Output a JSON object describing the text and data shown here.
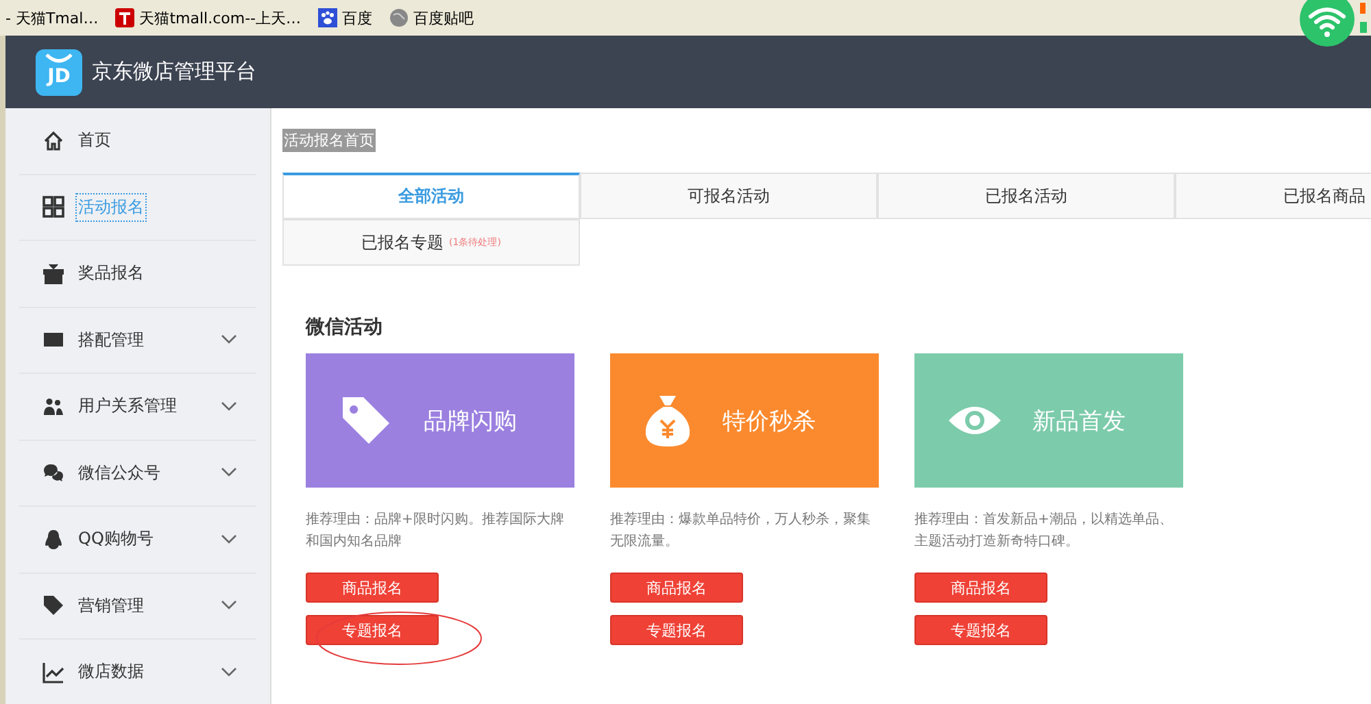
{
  "bookmarks": [
    "- 天猫Tmal…",
    "天猫tmall.com--上天…",
    "百度",
    "百度贴吧"
  ],
  "header": {
    "title": "京东微店管理平台",
    "logo": "JD"
  },
  "sidebar": {
    "items": [
      {
        "label": "首页",
        "selected": false,
        "expandable": false
      },
      {
        "label": "活动报名",
        "selected": true,
        "expandable": false
      },
      {
        "label": "奖品报名",
        "selected": false,
        "expandable": false
      },
      {
        "label": "搭配管理",
        "selected": false,
        "expandable": true
      },
      {
        "label": "用户关系管理",
        "selected": false,
        "expandable": true
      },
      {
        "label": "微信公众号",
        "selected": false,
        "expandable": true
      },
      {
        "label": "QQ购物号",
        "selected": false,
        "expandable": true
      },
      {
        "label": "营销管理",
        "selected": false,
        "expandable": true
      },
      {
        "label": "微店数据",
        "selected": false,
        "expandable": true
      }
    ]
  },
  "breadcrumb": "活动报名首页",
  "tabs": [
    {
      "label": "全部活动",
      "selected": true
    },
    {
      "label": "可报名活动",
      "selected": false
    },
    {
      "label": "已报名活动",
      "selected": false
    },
    {
      "label": "已报名商品",
      "selected": false
    },
    {
      "label": "已报名专题",
      "note": "(1条待处理)",
      "selected": false
    }
  ],
  "section_title": "微信活动",
  "cards": [
    {
      "title": "品牌闪购",
      "color": "#9b80e0",
      "description": "推荐理由：品牌+限时闪购。推荐国际大牌和国内知名品牌",
      "buttons": [
        "商品报名",
        "专题报名"
      ],
      "circled": true
    },
    {
      "title": "特价秒杀",
      "color": "#fb8a2e",
      "description": "推荐理由：爆款单品特价，万人秒杀，聚集无限流量。",
      "buttons": [
        "商品报名",
        "专题报名"
      ],
      "circled": false
    },
    {
      "title": "新品首发",
      "color": "#7ccbab",
      "description": "推荐理由：首发新品+潮品，以精选单品、主题活动打造新奇特口碑。",
      "buttons": [
        "商品报名",
        "专题报名"
      ],
      "circled": false
    }
  ]
}
